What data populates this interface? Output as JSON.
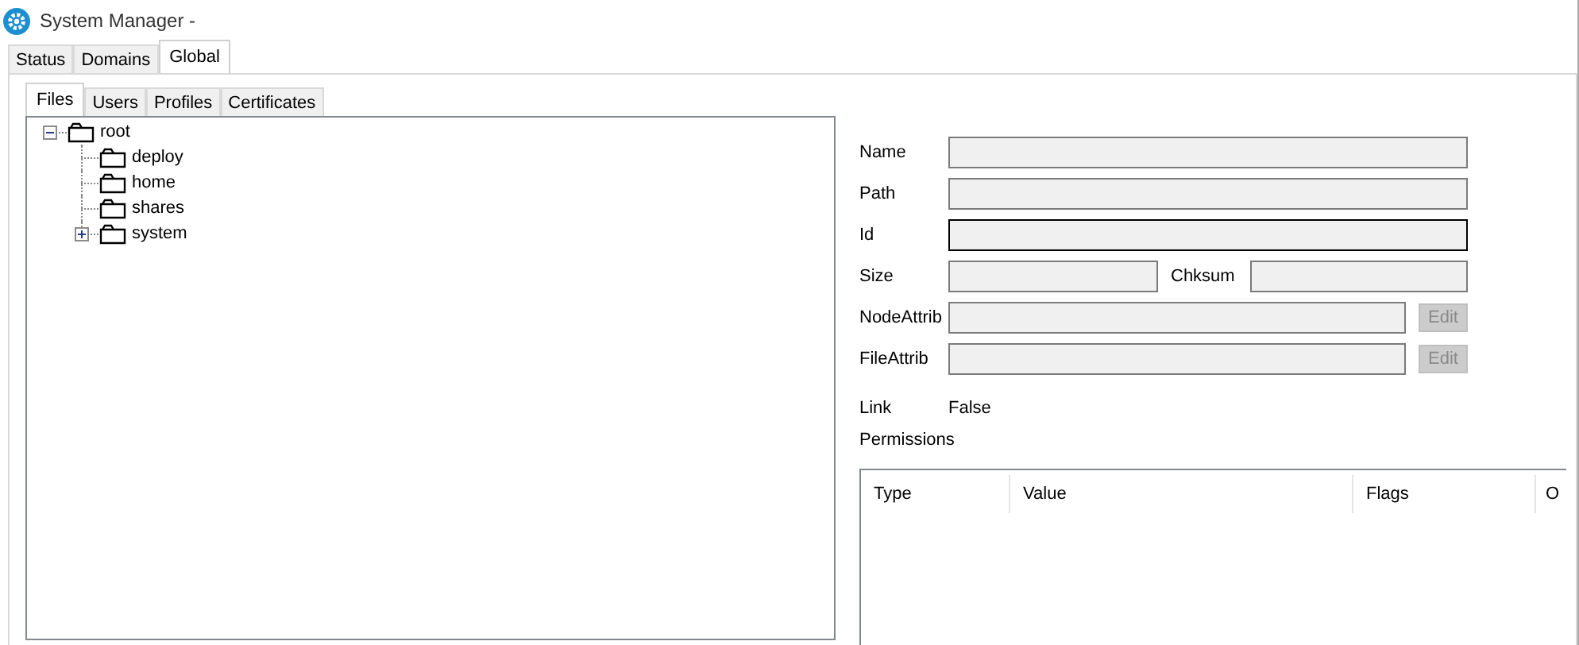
{
  "window": {
    "title": "System Manager -"
  },
  "tabs": [
    {
      "label": "Status",
      "selected": false
    },
    {
      "label": "Domains",
      "selected": false
    },
    {
      "label": "Global",
      "selected": true
    }
  ],
  "subtabs": [
    {
      "label": "Files",
      "selected": true
    },
    {
      "label": "Users",
      "selected": false
    },
    {
      "label": "Profiles",
      "selected": false
    },
    {
      "label": "Certificates",
      "selected": false
    }
  ],
  "tree": {
    "items": [
      {
        "label": "root",
        "kind": "expandable",
        "expanded": true,
        "children": [
          {
            "label": "deploy",
            "kind": "leaf"
          },
          {
            "label": "home",
            "kind": "leaf"
          },
          {
            "label": "shares",
            "kind": "leaf"
          },
          {
            "label": "system",
            "kind": "expandable",
            "expanded": false
          }
        ]
      }
    ]
  },
  "form": {
    "rows": [
      {
        "kind": "field",
        "label": "Name",
        "focused": false
      },
      {
        "kind": "field",
        "label": "Path",
        "focused": false
      },
      {
        "kind": "field",
        "label": "Id",
        "focused": true
      },
      {
        "kind": "pair",
        "label": "Size",
        "focused": false,
        "label2": "Chksum",
        "focused2": false
      },
      {
        "kind": "edit",
        "label": "NodeAttrib",
        "focused": false,
        "button": {
          "label": "Edit",
          "disabled": true
        }
      },
      {
        "kind": "edit",
        "label": "FileAttrib",
        "focused": false,
        "button": {
          "label": "Edit",
          "disabled": true
        }
      }
    ],
    "link": {
      "label": "Link",
      "value": "False"
    },
    "permissions": {
      "label": "Permissions",
      "columns": [
        "Type",
        "Value",
        "Flags",
        "O"
      ]
    }
  }
}
